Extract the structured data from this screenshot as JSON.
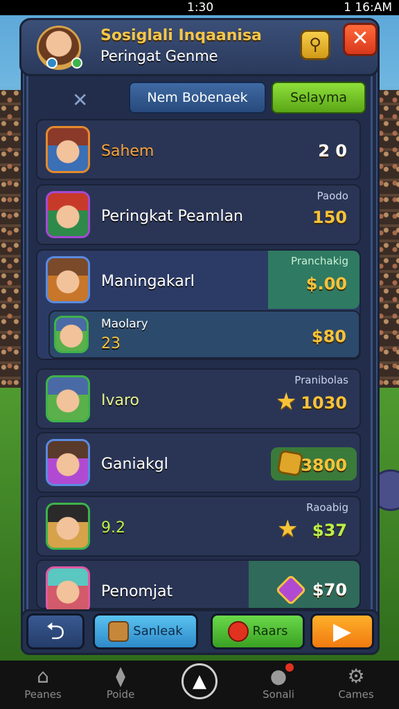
{
  "status_bar": {
    "time": "1:30",
    "right": "1 16:AM"
  },
  "header": {
    "title": "Sosiglali Inqaanisa",
    "subtitle": "Peringat Genme"
  },
  "tabs": {
    "close": "✕",
    "tab1": "Nem Bobenaek",
    "tab2": "Selayma"
  },
  "rows": [
    {
      "name": "Sahem",
      "label": "",
      "score": "2 0"
    },
    {
      "name": "Peringkat Peamlan",
      "label": "Paodo",
      "score": "150"
    },
    {
      "name": "Maningakarl",
      "label": "Pranchakig",
      "score": "$.00"
    },
    {
      "name": "Maolary",
      "sub_value": "23",
      "score": "$80"
    },
    {
      "name": "Ivaro",
      "label": "Pranibolas",
      "score": "1030"
    },
    {
      "name": "Ganiakgl",
      "label": "",
      "score": "3800"
    },
    {
      "name": "9.2",
      "label": "Raoabig",
      "score": "$37"
    },
    {
      "name": "Penomjat",
      "label": "",
      "score": "$70"
    }
  ],
  "actions": {
    "back": "⮌",
    "send": "Sanleak",
    "rare": "Raars",
    "play": "▶"
  },
  "nav": {
    "item1": "Peanes",
    "item2": "Poide",
    "item3": "Sonali",
    "item4": "Cames"
  }
}
